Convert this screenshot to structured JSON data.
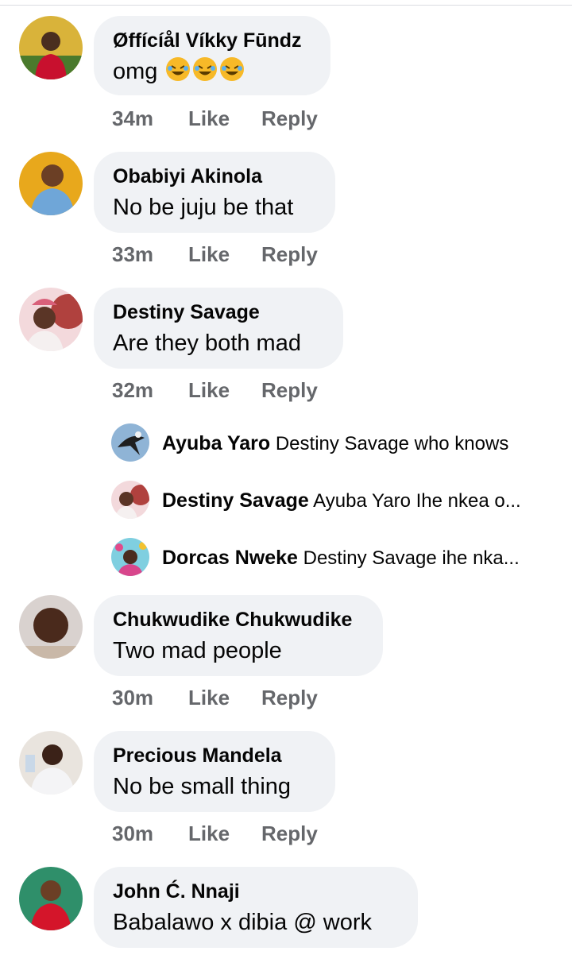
{
  "comments": [
    {
      "author": "Øffícíål Víkky Fūndz",
      "text": "omg",
      "emoji_count": 3,
      "time": "34m",
      "like": "Like",
      "reply": "Reply"
    },
    {
      "author": "Obabiyi Akinola",
      "text": "No be juju be that",
      "time": "33m",
      "like": "Like",
      "reply": "Reply"
    },
    {
      "author": "Destiny Savage",
      "text": "Are they both mad",
      "time": "32m",
      "like": "Like",
      "reply": "Reply"
    },
    {
      "author": "Chukwudike Chukwudike",
      "text": "Two mad people",
      "time": "30m",
      "like": "Like",
      "reply": "Reply"
    },
    {
      "author": "Precious Mandela",
      "text": "No be small thing",
      "time": "30m",
      "like": "Like",
      "reply": "Reply"
    },
    {
      "author": "John Ć. Nnaji",
      "text": "Babalawo x dibia @ work"
    }
  ],
  "replies": [
    {
      "author": "Ayuba Yaro",
      "text": "Destiny Savage who knows"
    },
    {
      "author": "Destiny Savage",
      "text": "Ayuba Yaro Ihe nkea o..."
    },
    {
      "author": "Dorcas Nweke",
      "text": "Destiny Savage ihe nka..."
    }
  ],
  "colors": {
    "bubble": "#f0f2f5",
    "meta": "#65676b",
    "text": "#050505"
  }
}
